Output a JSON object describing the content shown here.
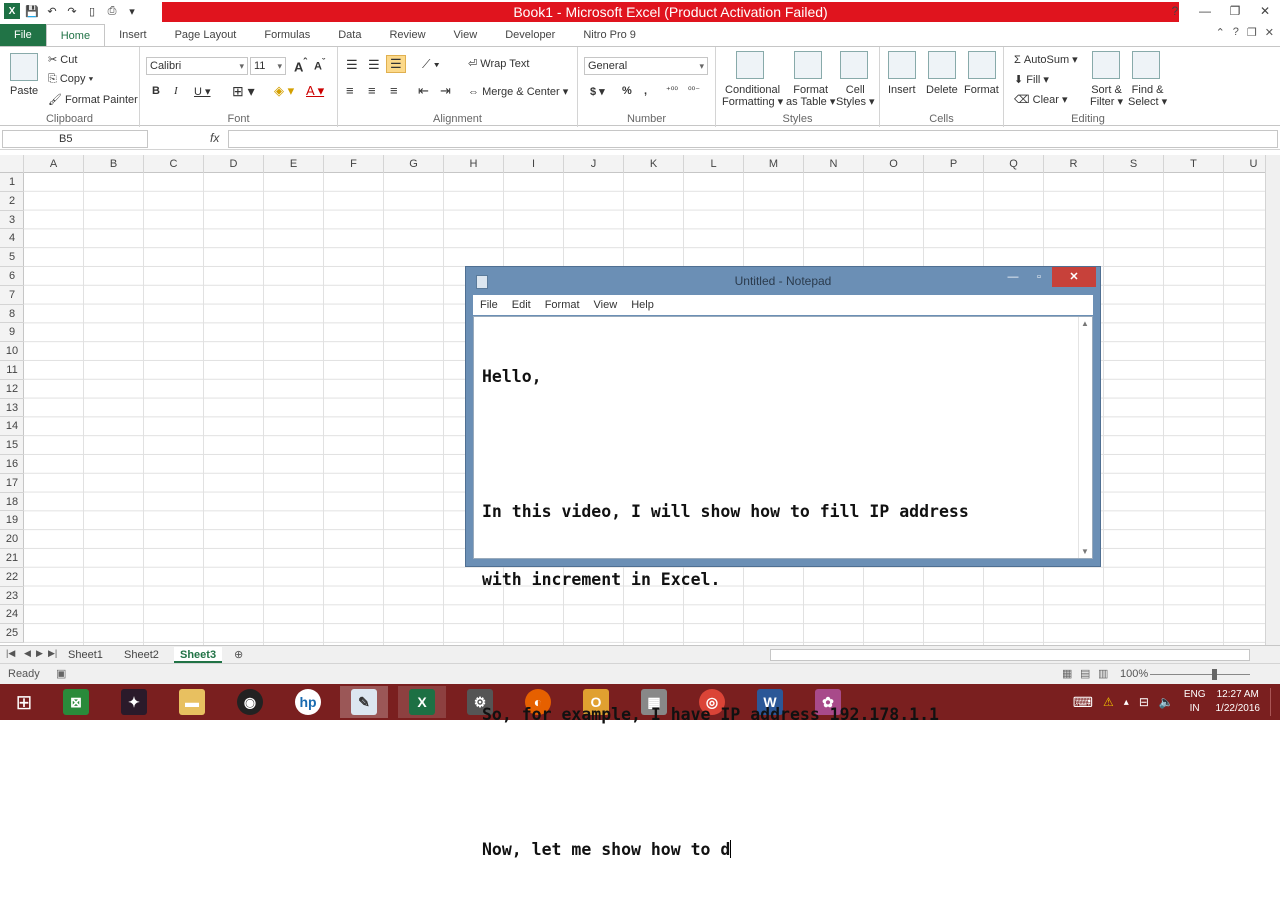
{
  "window": {
    "title": "Book1 - Microsoft Excel (Product Activation Failed)",
    "minimize": "—",
    "restore": "❐",
    "close": "✕"
  },
  "ribbon_tabs": [
    "File",
    "Home",
    "Insert",
    "Page Layout",
    "Formulas",
    "Data",
    "Review",
    "View",
    "Developer",
    "Nitro Pro 9"
  ],
  "active_tab": "Home",
  "ribbon": {
    "clipboard": {
      "paste": "Paste",
      "cut": "Cut",
      "copy": "Copy ▾",
      "format_painter": "Format Painter",
      "label": "Clipboard"
    },
    "font": {
      "name": "Calibri",
      "size": "11",
      "label": "Font"
    },
    "alignment": {
      "wrap_text": "Wrap Text",
      "merge_center": "Merge & Center ▾",
      "label": "Alignment"
    },
    "number": {
      "format": "General",
      "label": "Number"
    },
    "styles": {
      "conditional": "Conditional",
      "conditional2": "Formatting ▾",
      "format_table": "Format",
      "format_table2": "as Table ▾",
      "cell_styles": "Cell",
      "cell_styles2": "Styles ▾",
      "label": "Styles"
    },
    "cells": {
      "insert": "Insert",
      "delete": "Delete",
      "format": "Format",
      "label": "Cells"
    },
    "editing": {
      "autosum": "AutoSum ▾",
      "fill": "Fill ▾",
      "clear": "Clear ▾",
      "sort": "Sort &",
      "sort2": "Filter ▾",
      "find": "Find &",
      "find2": "Select ▾",
      "label": "Editing"
    }
  },
  "formula_bar": {
    "name_box": "B5",
    "fx": "fx",
    "value": ""
  },
  "columns": [
    "A",
    "B",
    "C",
    "D",
    "E",
    "F",
    "G",
    "H",
    "I",
    "J",
    "K",
    "L",
    "M",
    "N",
    "O",
    "P",
    "Q",
    "R",
    "S",
    "T",
    "U"
  ],
  "rows": [
    "1",
    "2",
    "3",
    "4",
    "5",
    "6",
    "7",
    "8",
    "9",
    "10",
    "11",
    "12",
    "13",
    "14",
    "15",
    "16",
    "17",
    "18",
    "19",
    "20",
    "21",
    "22",
    "23",
    "24",
    "25"
  ],
  "sheets": [
    "Sheet1",
    "Sheet2",
    "Sheet3"
  ],
  "active_sheet": "Sheet3",
  "status": {
    "ready": "Ready",
    "zoom": "100%",
    "zoom_level": 100
  },
  "notepad": {
    "title": "Untitled - Notepad",
    "menu": [
      "File",
      "Edit",
      "Format",
      "View",
      "Help"
    ],
    "lines": [
      "Hello,",
      "",
      "In this video, I will show how to fill IP address",
      "with increment in Excel.",
      "",
      "So, for example, I have IP address 192.178.1.1",
      "",
      "Now, let me show how to d"
    ]
  },
  "taskbar": {
    "tray": {
      "lang1": "ENG",
      "lang2": "IN",
      "time": "12:27 AM",
      "date": "1/22/2016"
    }
  },
  "colors": {
    "excel_green": "#217346",
    "title_red": "#e0141e",
    "taskbar": "#7a1f1f",
    "notepad_frame": "#6b8fb5"
  }
}
